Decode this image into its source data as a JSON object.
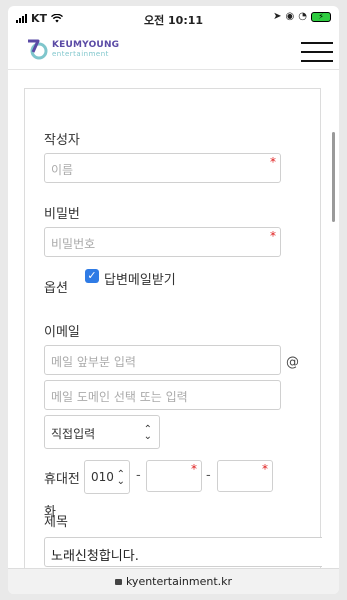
{
  "status_bar": {
    "carrier": "KT",
    "time": "오전 10:11",
    "battery_label": "⚡"
  },
  "header": {
    "logo_name": "KEUMYOUNG",
    "logo_sub": "entertainment"
  },
  "form": {
    "author_label": "작성자",
    "name_placeholder": "이름",
    "password_label": "비밀번",
    "password_placeholder": "비밀번호",
    "options_label": "옵션",
    "reply_mail_checkbox": "답변메일받기",
    "reply_mail_checked": true,
    "email_label": "이메일",
    "email_local_placeholder": "메일 앞부분 입력",
    "at_sign": "@",
    "email_domain_placeholder": "메일 도메인 선택 또는 입력",
    "email_domain_select": "직접입력",
    "phone_label": "휴대전",
    "phone_prefix": "010",
    "phone_dash": "-",
    "phone_label_overflow": "화",
    "subject_label": "제목",
    "subject_value": "노래신청합니다."
  },
  "browser": {
    "url": "kyentertainment.kr"
  },
  "colors": {
    "required": "#e02020",
    "checkbox": "#2f7be5",
    "brand": "#5a4aa5"
  }
}
